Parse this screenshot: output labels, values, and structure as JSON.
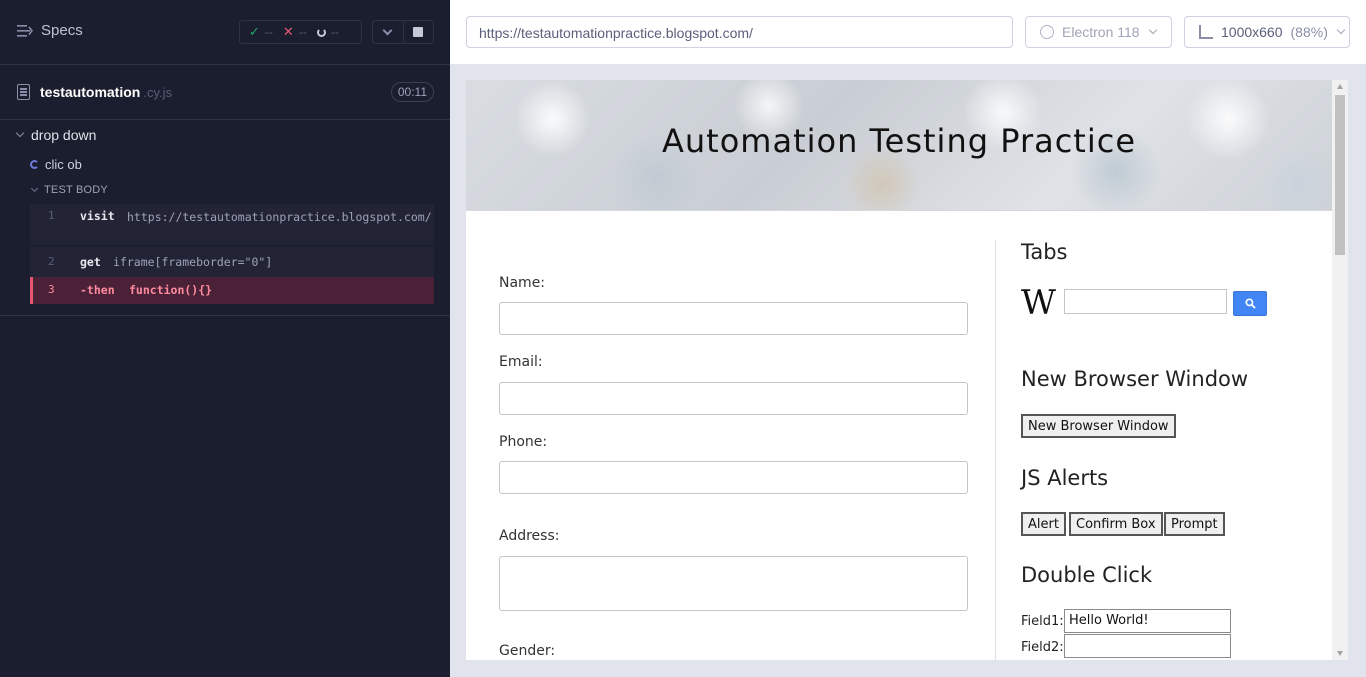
{
  "reporter": {
    "specs_label": "Specs",
    "stats": {
      "passed": "--",
      "failed": "--",
      "pending": "--"
    },
    "spec": {
      "name": "testautomation",
      "ext": ".cy.js",
      "duration": "00:11"
    },
    "suite_title": "drop down",
    "test_title": "clic ob",
    "body_title": "TEST BODY",
    "commands": [
      {
        "num": "1",
        "name": "visit",
        "message": "https://testautomationpractice.blogspot.com/"
      },
      {
        "num": "2",
        "name": "get",
        "message": "iframe[frameborder=\"0\"]"
      },
      {
        "num": "3",
        "name": "-then",
        "message": "function(){}"
      }
    ]
  },
  "aut": {
    "url": "https://testautomationpractice.blogspot.com/",
    "browser": "Electron 118",
    "viewport": "1000x660",
    "zoom": "(88%)"
  },
  "page": {
    "title": "Automation Testing Practice",
    "form": {
      "name_label": "Name:",
      "email_label": "Email:",
      "phone_label": "Phone:",
      "address_label": "Address:",
      "gender_label": "Gender:"
    },
    "sidebar": {
      "tabs_heading": "Tabs",
      "wiki_logo": "W",
      "new_window_heading": "New Browser Window",
      "new_window_button": "New Browser Window",
      "alerts_heading": "JS Alerts",
      "alert_button": "Alert",
      "confirm_button": "Confirm Box",
      "prompt_button": "Prompt",
      "double_click_heading": "Double Click",
      "field1_label": "Field1:",
      "field1_value": "Hello World!",
      "field2_label": "Field2:",
      "field2_value": ""
    }
  },
  "colors": {
    "reporter_bg": "#1b1e2e",
    "pass": "#1fa971",
    "fail": "#e45770",
    "wiki_button": "#4285f4"
  },
  "icons": [
    "list-icon",
    "check-icon",
    "x-icon",
    "spinner-icon",
    "chevron-down-icon",
    "stop-icon",
    "file-icon",
    "electron-icon",
    "ruler-icon",
    "search-icon"
  ]
}
